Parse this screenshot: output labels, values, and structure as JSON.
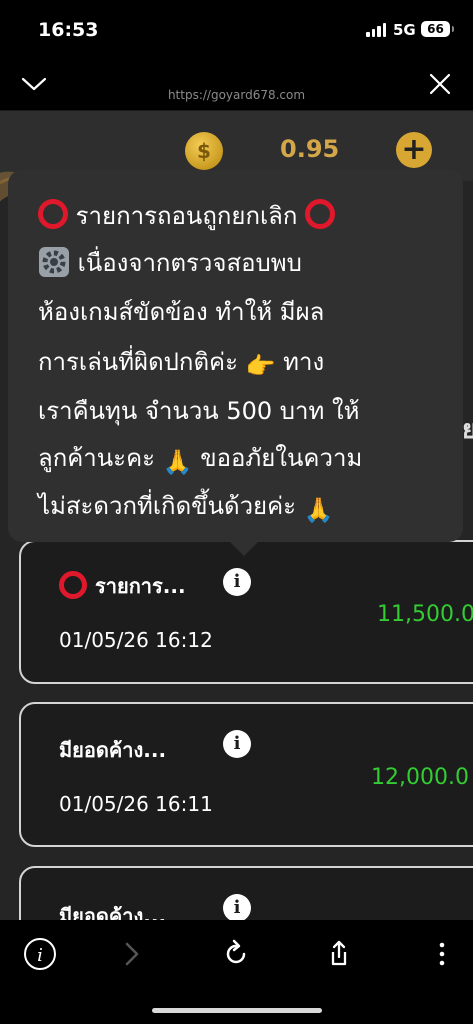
{
  "status": {
    "time": "16:53",
    "network": "5G",
    "battery": "66"
  },
  "browser": {
    "url": "https://goyard678.com"
  },
  "wallet": {
    "balance": "0.95",
    "coin_symbol": "$",
    "add_symbol": "+"
  },
  "side_glyph": "ย",
  "tooltip": {
    "title": "รายการถอนถูกยกเลิก",
    "line2": "เนื่องจากตรวจสอบพบ",
    "line3": "ห้องเกมส์ขัดข้อง ทำให้ มีผล",
    "line4": "การเล่นที่ผิดปกติค่ะ",
    "line4_emoji": "👉",
    "line4_tail": "ทาง",
    "line5": "เราคืนทุน จำนวน 500 บาท ให้",
    "line6": "ลูกค้านะคะ",
    "line6_emoji": "🙏",
    "line6_tail": "ขออภัยในความ",
    "line7": "ไม่สะดวกที่เกิดขึ้นด้วยค่ะ",
    "line7_emoji": "🙏"
  },
  "transactions": [
    {
      "title": "รายการ...",
      "date": "01/05/26 16:12",
      "amount": "11,500.0"
    },
    {
      "title": "มียอดค้าง...",
      "date": "01/05/26 16:11",
      "amount": "12,000.0"
    },
    {
      "title": "มียอดค้าง...",
      "date": "",
      "amount": ""
    }
  ],
  "icons": {
    "info": "i",
    "toolbar": [
      "info-circle-icon",
      "forward-arrow-icon",
      "reload-icon",
      "share-icon",
      "more-vertical-icon"
    ]
  },
  "colors": {
    "amount": "#33cc33",
    "cancel_ring": "#e0182b",
    "coin_gold": "#d3a64a"
  }
}
